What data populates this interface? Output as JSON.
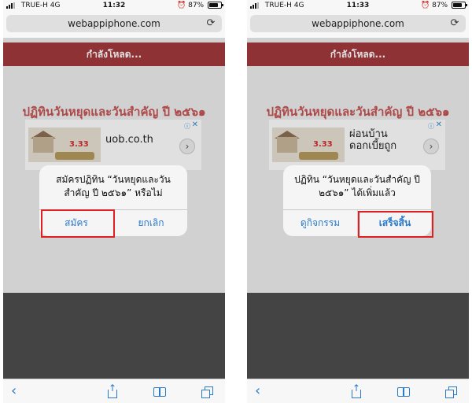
{
  "colors": {
    "accent": "#2a7ac9",
    "loading_bar": "#a33a3e",
    "heading": "#c65454",
    "highlight": "#e02020"
  },
  "left": {
    "status": {
      "carrier": "TRUE-H",
      "network": "4G",
      "time": "11:32",
      "battery_pct": "87%",
      "battery_level": 0.87
    },
    "url": "webappiphone.com",
    "loading_label": "กำลังโหลด...",
    "heading": "ปฏิทินวันหยุดและวันสำคัญ ปี ๒๕๖๑",
    "ad": {
      "rate": "3.33",
      "text": "uob.co.th",
      "icon": "info-icon"
    },
    "dialog": {
      "message": "สมัครปฏิทิน “วันหยุดและวันสำคัญ ปี ๒๕๖๑” หรือไม่",
      "left_button": "สมัคร",
      "right_button": "ยกเลิก",
      "highlighted": "left_button"
    }
  },
  "right": {
    "status": {
      "carrier": "TRUE-H",
      "network": "4G",
      "time": "11:33",
      "battery_pct": "87%",
      "battery_level": 0.87
    },
    "url": "webappiphone.com",
    "loading_label": "กำลังโหลด...",
    "heading": "ปฏิทินวันหยุดและวันสำคัญ ปี ๒๕๖๑",
    "ad": {
      "rate": "3.33",
      "text": "ผ่อนบ้าน ดอกเบี้ยถูก",
      "icon": "info-icon"
    },
    "dialog": {
      "message": "ปฏิทิน “วันหยุดและวันสำคัญ ปี ๒๕๖๑” ได้เพิ่มแล้ว",
      "left_button": "ดูกิจกรรม",
      "right_button": "เสร็จสิ้น",
      "highlighted": "right_button"
    }
  },
  "toolbar_icons": [
    "back-icon",
    "share-icon",
    "bookmarks-icon",
    "tabs-icon"
  ]
}
